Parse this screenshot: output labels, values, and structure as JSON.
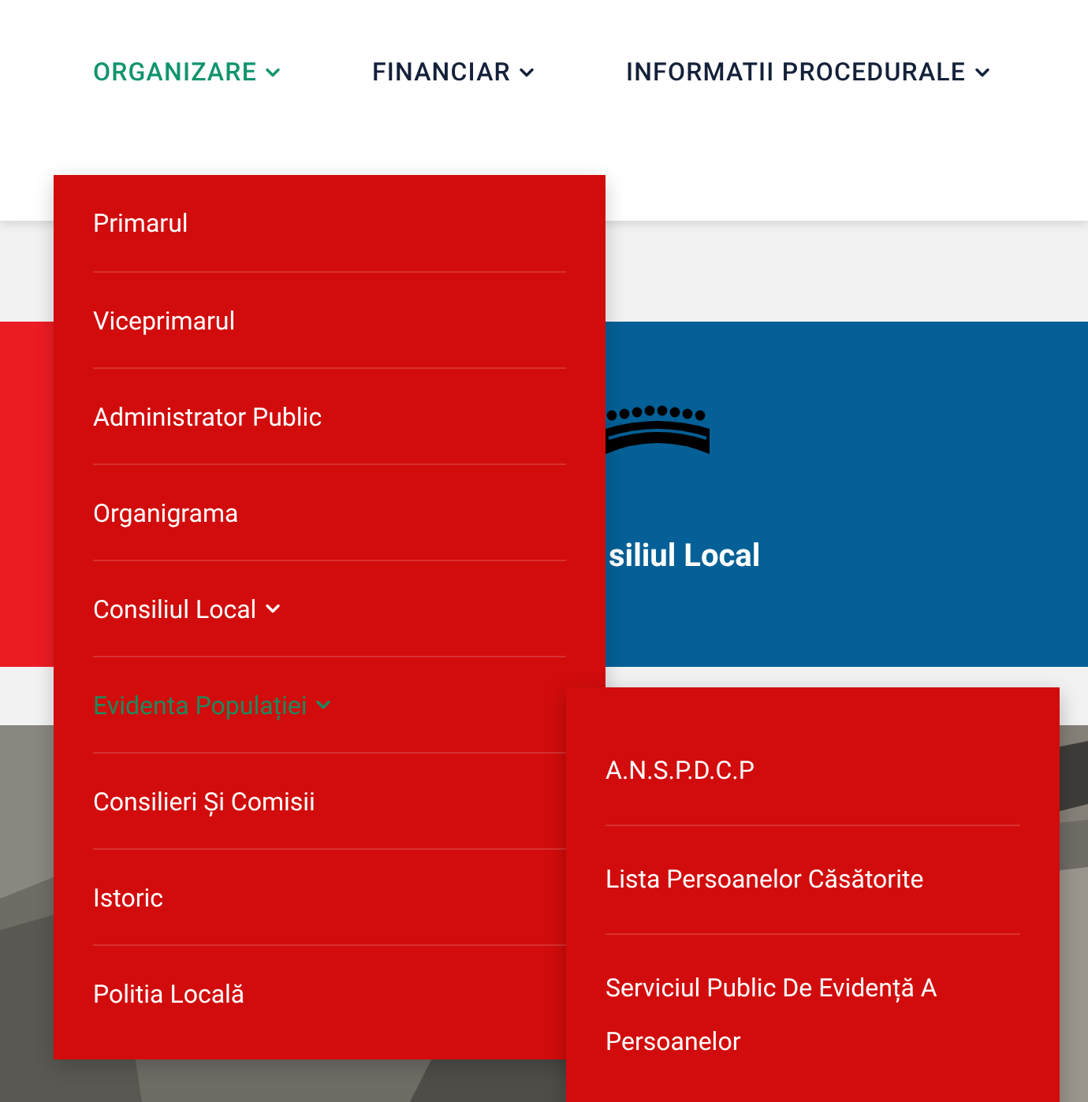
{
  "nav": [
    {
      "label": "ORGANIZARE",
      "selected": true,
      "has_submenu": true
    },
    {
      "label": "FINANCIAR",
      "selected": false,
      "has_submenu": true
    },
    {
      "label": "INFORMATII PROCEDURALE",
      "selected": false,
      "has_submenu": true
    }
  ],
  "banner": {
    "title": "siliul Local"
  },
  "dropdown": {
    "items": [
      {
        "label": "Primarul",
        "selected": false,
        "has_submenu": false
      },
      {
        "label": "Viceprimarul",
        "selected": false,
        "has_submenu": false
      },
      {
        "label": "Administrator Public",
        "selected": false,
        "has_submenu": false
      },
      {
        "label": "Organigrama",
        "selected": false,
        "has_submenu": false
      },
      {
        "label": "Consiliul Local",
        "selected": false,
        "has_submenu": true
      },
      {
        "label": "Evidenta Populației",
        "selected": true,
        "has_submenu": true
      },
      {
        "label": "Consilieri Și Comisii",
        "selected": false,
        "has_submenu": false
      },
      {
        "label": "Istoric",
        "selected": false,
        "has_submenu": false
      },
      {
        "label": "Politia Locală",
        "selected": false,
        "has_submenu": false
      }
    ]
  },
  "submenu": {
    "items": [
      {
        "label": "A.N.S.P.D.C.P"
      },
      {
        "label": "Lista Persoanelor Căsătorite"
      },
      {
        "label": "Serviciul Public De Evidență A Persoanelor"
      }
    ]
  }
}
